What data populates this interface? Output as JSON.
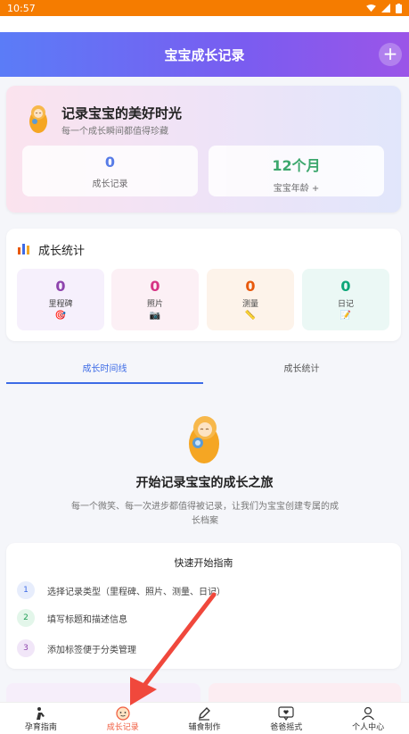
{
  "status_bar": {
    "time": "10:57"
  },
  "header": {
    "title": "宝宝成长记录",
    "add_label": "+"
  },
  "hero": {
    "title": "记录宝宝的美好时光",
    "subtitle": "每一个成长瞬间都值得珍藏",
    "cards": [
      {
        "value": "0",
        "label": "成长记录",
        "color": "#3d6be6"
      },
      {
        "value": "12个月",
        "label": "宝宝年龄 +",
        "color": "#1f9d55"
      }
    ]
  },
  "stats": {
    "title": "成长统计",
    "items": [
      {
        "value": "0",
        "label": "里程碑",
        "icon": "🎯",
        "color": "#8e44ad",
        "bg": "#f6f0fc"
      },
      {
        "value": "0",
        "label": "照片",
        "icon": "📷",
        "color": "#d63384",
        "bg": "#fcf0f5"
      },
      {
        "value": "0",
        "label": "测量",
        "icon": "📏",
        "color": "#e8590c",
        "bg": "#fdf3ea"
      },
      {
        "value": "0",
        "label": "日记",
        "icon": "📝",
        "color": "#0ca678",
        "bg": "#ebf8f5"
      }
    ]
  },
  "tabs": [
    {
      "label": "成长时间线",
      "active": true
    },
    {
      "label": "成长统计",
      "active": false
    }
  ],
  "empty_state": {
    "title": "开始记录宝宝的成长之旅",
    "description": "每一个微笑、每一次进步都值得被记录，让我们为宝宝创建专属的成长档案"
  },
  "guide": {
    "title": "快速开始指南",
    "steps": [
      {
        "num": "1",
        "text": "选择记录类型（里程碑、照片、测量、日记）",
        "color": "#3d6be6",
        "bg": "#e7edfc"
      },
      {
        "num": "2",
        "text": "填写标题和描述信息",
        "color": "#1f9d55",
        "bg": "#e3f6ea"
      },
      {
        "num": "3",
        "text": "添加标签便于分类管理",
        "color": "#8e44ad",
        "bg": "#f1e6f8"
      }
    ]
  },
  "bottom_nav": [
    {
      "label": "孕育指南",
      "icon": "person-icon",
      "active": false
    },
    {
      "label": "成长记录",
      "icon": "baby-face-icon",
      "active": true
    },
    {
      "label": "辅食制作",
      "icon": "pencil-icon",
      "active": false
    },
    {
      "label": "爸爸摇式",
      "icon": "chat-heart-icon",
      "active": false
    },
    {
      "label": "个人中心",
      "icon": "user-icon",
      "active": false
    }
  ]
}
